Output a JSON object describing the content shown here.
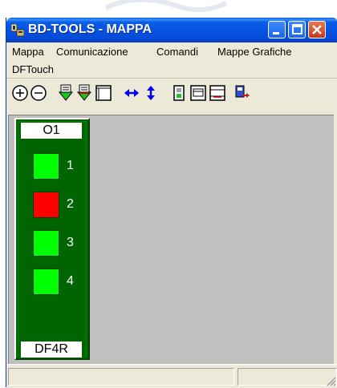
{
  "window": {
    "title": "BD-TOOLS - MAPPA",
    "controls": [
      "minimize",
      "maximize",
      "close"
    ]
  },
  "menu": {
    "items": [
      {
        "id": "mappa",
        "label": "Mappa"
      },
      {
        "id": "comunicazione",
        "label": "Comunicazione"
      },
      {
        "id": "comandi",
        "label": "Comandi"
      },
      {
        "id": "mappe_grafiche",
        "label": "Mappe Grafiche"
      },
      {
        "id": "dftouch",
        "label": "DFTouch"
      }
    ]
  },
  "toolbar": {
    "buttons": [
      {
        "id": "zoom-in",
        "icon": "zoom-in-icon"
      },
      {
        "id": "zoom-out",
        "icon": "zoom-out-icon"
      },
      {
        "id": "download-1",
        "icon": "download-icon"
      },
      {
        "id": "download-2",
        "icon": "download-icon"
      },
      {
        "id": "window",
        "icon": "window-icon"
      },
      {
        "id": "h-resize",
        "icon": "arrows-horizontal-icon"
      },
      {
        "id": "v-resize",
        "icon": "arrows-vertical-icon"
      },
      {
        "id": "device-1",
        "icon": "device-icon"
      },
      {
        "id": "device-2",
        "icon": "panel-icon"
      },
      {
        "id": "device-3",
        "icon": "panel-icon"
      },
      {
        "id": "transfer",
        "icon": "transfer-icon"
      }
    ]
  },
  "module": {
    "header": "O1",
    "footer": "DF4R",
    "channels": [
      {
        "number": "1",
        "state": "on",
        "color": "#00ff00"
      },
      {
        "number": "2",
        "state": "alarm",
        "color": "#ff0000"
      },
      {
        "number": "3",
        "state": "on",
        "color": "#00ff00"
      },
      {
        "number": "4",
        "state": "on",
        "color": "#00ff00"
      }
    ],
    "colors": {
      "body": "#006400",
      "ok": "#00ff00",
      "alarm": "#ff0000"
    }
  },
  "status": {
    "pane1": "",
    "pane2": ""
  }
}
